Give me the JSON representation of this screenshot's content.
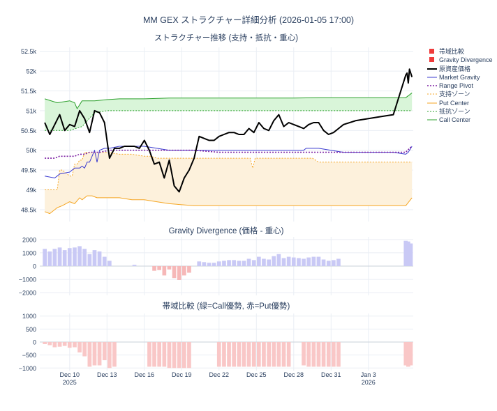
{
  "title": "MM GEX ストラクチャー詳細分析 (2026-01-05 17:00)",
  "panels": {
    "top_title": "ストラクチャー推移 (支持・抵抗・重心)",
    "mid_title": "Gravity Divergence (価格 - 重心)",
    "bot_title": "帯域比較 (緑=Call優勢, 赤=Put優勢)"
  },
  "colors": {
    "price": "#000000",
    "gravity": "#3a3acf",
    "pivot": "#7b1fa2",
    "support": "#f5a623",
    "put_center": "#f5a623",
    "resist": "#2ca02c",
    "call_center": "#2ca02c",
    "support_fill": "#fdf1dc",
    "resist_fill": "#d9f5d9",
    "div_pos": "#c9c9f5",
    "div_neg": "#f6b8b8",
    "band_neg": "#f9c7c7",
    "legend_square": "#ef3b3b",
    "grid": "#eaeef4",
    "zero": "#c9d0da"
  },
  "x_ticks": [
    {
      "label": "Dec 10",
      "sub": "2025",
      "day": 10
    },
    {
      "label": "Dec 13",
      "sub": "",
      "day": 13
    },
    {
      "label": "Dec 16",
      "sub": "",
      "day": 16
    },
    {
      "label": "Dec 19",
      "sub": "",
      "day": 19
    },
    {
      "label": "Dec 22",
      "sub": "",
      "day": 22
    },
    {
      "label": "Dec 25",
      "sub": "",
      "day": 25
    },
    {
      "label": "Dec 28",
      "sub": "",
      "day": 28
    },
    {
      "label": "Dec 31",
      "sub": "",
      "day": 31
    },
    {
      "label": "Jan 3",
      "sub": "2026",
      "day": 34
    }
  ],
  "legend": [
    {
      "label": "帯域比較",
      "kind": "square",
      "color": "#ef3b3b"
    },
    {
      "label": "Gravity Divergence",
      "kind": "square",
      "color": "#ef3b3b"
    },
    {
      "label": "原資産価格",
      "kind": "line",
      "color": "#000000",
      "dash": "",
      "width": 2
    },
    {
      "label": "Market Gravity",
      "kind": "line",
      "color": "#3a3acf",
      "dash": "",
      "width": 1
    },
    {
      "label": "Range Pivot",
      "kind": "line",
      "color": "#7b1fa2",
      "dash": "2,2",
      "width": 1.6
    },
    {
      "label": "支持ゾーン",
      "kind": "line",
      "color": "#f5a623",
      "dash": "2,2",
      "width": 1
    },
    {
      "label": "Put Center",
      "kind": "line",
      "color": "#f5a623",
      "dash": "",
      "width": 1
    },
    {
      "label": "抵抗ゾーン",
      "kind": "line",
      "color": "#2ca02c",
      "dash": "2,2",
      "width": 1
    },
    {
      "label": "Call Center",
      "kind": "line",
      "color": "#2ca02c",
      "dash": "",
      "width": 1
    }
  ],
  "chart_data": [
    {
      "type": "line",
      "title": "ストラクチャー推移 (支持・抵抗・重心)",
      "x_unit": "days since 2025-12-01",
      "xlim": [
        7.6,
        37.6
      ],
      "ylim": [
        48200,
        52600
      ],
      "y_ticks": [
        48500,
        49000,
        49500,
        50000,
        50500,
        51000,
        51500,
        52000,
        52500
      ],
      "y_tick_labels": [
        "48.5k",
        "49k",
        "49.5k",
        "50k",
        "50.5k",
        "51k",
        "51.5k",
        "52k",
        "52.5k"
      ],
      "series": [
        {
          "name": "原資産価格",
          "x": [
            8.0,
            8.4,
            8.8,
            9.2,
            9.6,
            10.0,
            10.4,
            10.8,
            11.2,
            11.6,
            12.0,
            12.4,
            12.8,
            13.2,
            13.6,
            14.0,
            14.4,
            14.8,
            15.2,
            15.6,
            16.0,
            16.4,
            16.8,
            17.2,
            17.6,
            18.0,
            18.4,
            18.8,
            19.2,
            19.6,
            20.0,
            20.4,
            20.8,
            21.2,
            21.6,
            22.0,
            22.4,
            22.8,
            23.2,
            23.6,
            24.0,
            24.4,
            24.8,
            25.2,
            25.6,
            26.0,
            26.4,
            26.8,
            27.2,
            27.6,
            28.0,
            28.4,
            28.8,
            29.2,
            29.6,
            30.0,
            30.4,
            30.8,
            31.2,
            31.6,
            32.0,
            33.0,
            34.0,
            35.0,
            36.0,
            37.0,
            37.1,
            37.2,
            37.3,
            37.4,
            37.5
          ],
          "y": [
            50700,
            50400,
            50650,
            50900,
            50500,
            50650,
            50600,
            51000,
            50800,
            50450,
            51000,
            50950,
            50700,
            49800,
            50050,
            50050,
            50100,
            50100,
            50100,
            50050,
            50250,
            50000,
            49650,
            49700,
            49300,
            49750,
            49100,
            48950,
            49300,
            49500,
            49800,
            50350,
            50300,
            50250,
            50250,
            50350,
            50400,
            50450,
            50450,
            50400,
            50400,
            50550,
            50450,
            50700,
            50550,
            50500,
            50750,
            50900,
            50600,
            50700,
            50650,
            50600,
            50550,
            50650,
            50700,
            50700,
            50500,
            50400,
            50450,
            50550,
            50650,
            50750,
            50800,
            50850,
            50900,
            51900,
            51950,
            51700,
            52050,
            51950,
            51850
          ]
        },
        {
          "name": "Market Gravity",
          "x": [
            8.0,
            8.8,
            9.2,
            10.0,
            10.4,
            10.8,
            11.0,
            11.2,
            11.4,
            11.6,
            11.8,
            12.0,
            12.2,
            12.4,
            12.8,
            13.2,
            14.0,
            16.0,
            18.0,
            20.0,
            22.0,
            24.0,
            26.0,
            28.0,
            28.8,
            29.0,
            30.0,
            31.0,
            32.0,
            34.0,
            36.0,
            37.0,
            37.2,
            37.5
          ],
          "y": [
            49350,
            49300,
            49400,
            49450,
            49550,
            49550,
            49600,
            49550,
            49700,
            49700,
            49850,
            50000,
            49700,
            50000,
            50050,
            50050,
            50100,
            50100,
            50000,
            50000,
            50000,
            50000,
            50000,
            50000,
            50000,
            50050,
            50050,
            50000,
            49950,
            49950,
            49950,
            49900,
            49950,
            50100
          ]
        },
        {
          "name": "Range Pivot",
          "x": [
            8.0,
            8.8,
            9.2,
            10.0,
            10.4,
            10.8,
            11.2,
            11.6,
            12.0,
            12.4,
            13.2,
            14.0,
            16.0,
            18.0,
            20.0,
            22.0,
            24.0,
            26.0,
            28.0,
            30.0,
            32.0,
            34.0,
            36.0,
            37.0,
            37.3,
            37.5
          ],
          "y": [
            49800,
            49800,
            49850,
            49850,
            49850,
            49900,
            49900,
            49950,
            49950,
            49950,
            50000,
            50000,
            50000,
            50000,
            50000,
            49950,
            49950,
            49950,
            49950,
            49950,
            49950,
            49950,
            49950,
            49950,
            50050,
            50100
          ]
        },
        {
          "name": "支持ゾーン",
          "x": [
            8.0,
            8.2,
            9.0,
            9.2,
            9.4,
            10.0,
            10.2,
            10.4,
            10.6,
            10.8,
            11.0,
            11.2,
            11.4,
            11.6,
            12.0,
            12.4,
            13.0,
            14.0,
            15.0,
            16.0,
            16.5,
            17.0,
            18.0,
            19.0,
            20.0,
            21.0,
            22.0,
            23.0,
            24.0,
            24.5,
            24.7,
            24.9,
            25.1,
            26.0,
            27.0,
            28.0,
            29.0,
            29.5,
            30.0,
            31.0,
            32.0,
            33.0,
            34.0,
            35.0,
            36.0,
            37.0,
            37.5
          ],
          "y": [
            49000,
            49000,
            49000,
            49500,
            49500,
            49350,
            49350,
            49650,
            49650,
            49750,
            49750,
            49950,
            49950,
            49950,
            49950,
            49950,
            49950,
            49900,
            49900,
            49850,
            49850,
            49800,
            49800,
            49800,
            49800,
            49800,
            49800,
            49800,
            49800,
            49800,
            49550,
            49800,
            49800,
            49800,
            49800,
            49800,
            49800,
            49800,
            49700,
            49700,
            49700,
            49700,
            49700,
            49700,
            49700,
            49700,
            49700
          ]
        },
        {
          "name": "Put Center",
          "x": [
            8.0,
            8.4,
            9.0,
            9.4,
            10.0,
            10.4,
            10.8,
            11.0,
            11.4,
            11.8,
            12.2,
            12.6,
            13.0,
            14.0,
            15.0,
            16.0,
            17.0,
            18.0,
            20.0,
            22.0,
            24.0,
            26.0,
            28.0,
            30.0,
            32.0,
            34.0,
            36.0,
            37.0,
            37.5
          ],
          "y": [
            48450,
            48400,
            48550,
            48600,
            48700,
            48650,
            48800,
            48750,
            48850,
            48850,
            48800,
            48800,
            48800,
            48800,
            48750,
            48750,
            48700,
            48650,
            48600,
            48600,
            48600,
            48600,
            48600,
            48600,
            48600,
            48600,
            48600,
            48600,
            48800
          ]
        },
        {
          "name": "抵抗ゾーン",
          "x": [
            8.0,
            10.0,
            11.0,
            12.0,
            13.0,
            14.0,
            16.0,
            18.0,
            20.0,
            22.0,
            24.0,
            26.0,
            28.0,
            30.0,
            32.0,
            34.0,
            36.0,
            37.5
          ],
          "y": [
            50500,
            50500,
            50600,
            50950,
            51000,
            51000,
            51000,
            51000,
            51000,
            51000,
            51000,
            51000,
            51000,
            51000,
            51000,
            51000,
            51000,
            51000
          ]
        },
        {
          "name": "Call Center",
          "x": [
            8.0,
            9.0,
            10.0,
            10.4,
            10.6,
            11.0,
            12.0,
            13.0,
            14.0,
            16.0,
            18.0,
            20.0,
            22.0,
            24.0,
            26.0,
            28.0,
            30.0,
            32.0,
            34.0,
            36.0,
            37.0,
            37.3,
            37.5
          ],
          "y": [
            51300,
            51200,
            51250,
            51200,
            51050,
            51250,
            51250,
            51280,
            51300,
            51300,
            51320,
            51320,
            51320,
            51320,
            51320,
            51320,
            51330,
            51330,
            51330,
            51330,
            51330,
            51400,
            51450
          ]
        }
      ]
    },
    {
      "type": "bar",
      "title": "Gravity Divergence (価格 - 重心)",
      "ylim": [
        -2200,
        2200
      ],
      "y_ticks": [
        -2000,
        -1000,
        0,
        1000,
        2000
      ],
      "y_tick_labels": [
        "−2000",
        "−1000",
        "0",
        "1000",
        "2000"
      ],
      "x": [
        8.0,
        8.4,
        8.8,
        9.2,
        9.6,
        10.0,
        10.4,
        10.8,
        11.2,
        11.6,
        12.0,
        12.4,
        12.8,
        13.2,
        13.6,
        14.0,
        14.4,
        14.8,
        15.2,
        15.6,
        16.0,
        16.4,
        16.8,
        17.2,
        17.6,
        18.0,
        18.4,
        18.8,
        19.2,
        19.6,
        20.0,
        20.4,
        20.8,
        21.2,
        21.6,
        22.0,
        22.4,
        22.8,
        23.2,
        23.6,
        24.0,
        24.4,
        24.8,
        25.2,
        25.6,
        26.0,
        26.4,
        26.8,
        27.2,
        27.6,
        28.0,
        28.4,
        28.8,
        29.2,
        29.6,
        30.0,
        30.4,
        30.8,
        31.2,
        31.6,
        37.0,
        37.2,
        37.4
      ],
      "values": [
        1300,
        1100,
        1300,
        1400,
        1200,
        1350,
        1400,
        1500,
        1300,
        900,
        1200,
        1100,
        700,
        400,
        0,
        0,
        0,
        0,
        100,
        0,
        0,
        0,
        -350,
        -300,
        -700,
        -250,
        -900,
        -1050,
        -700,
        -500,
        0,
        350,
        300,
        250,
        250,
        350,
        400,
        450,
        450,
        400,
        400,
        550,
        450,
        700,
        550,
        500,
        750,
        900,
        600,
        700,
        650,
        600,
        550,
        650,
        700,
        700,
        500,
        400,
        450,
        550,
        1900,
        1850,
        1700
      ]
    },
    {
      "type": "bar",
      "title": "帯域比較 (緑=Call優勢, 赤=Put優勢)",
      "ylim": [
        -1100,
        1100
      ],
      "y_ticks": [
        -1000,
        -500,
        0,
        500,
        1000
      ],
      "y_tick_labels": [
        "−1000",
        "−500",
        "0",
        "500",
        "1000"
      ],
      "x": [
        8.0,
        8.4,
        8.8,
        9.2,
        9.6,
        10.0,
        10.4,
        10.8,
        11.2,
        11.6,
        12.0,
        12.4,
        12.8,
        13.2,
        13.6,
        14.0,
        14.4,
        14.8,
        15.2,
        15.6,
        16.0,
        16.4,
        16.8,
        17.2,
        17.6,
        18.0,
        18.4,
        18.8,
        19.2,
        19.6,
        20.0,
        20.4,
        20.8,
        21.2,
        21.6,
        22.0,
        22.4,
        22.8,
        23.2,
        23.6,
        24.0,
        24.4,
        24.8,
        25.2,
        25.6,
        26.0,
        26.4,
        26.8,
        27.2,
        27.6,
        28.0,
        28.4,
        28.8,
        29.2,
        29.6,
        30.0,
        30.4,
        30.8,
        31.2,
        31.6,
        37.0,
        37.2,
        37.4
      ],
      "values": [
        -80,
        -120,
        -200,
        -180,
        -150,
        -220,
        -200,
        -400,
        -550,
        -950,
        -900,
        -900,
        -700,
        -1000,
        -950,
        0,
        0,
        0,
        0,
        0,
        0,
        -950,
        -950,
        -950,
        -950,
        -1000,
        -1000,
        -1000,
        -1000,
        -1000,
        0,
        0,
        0,
        0,
        0,
        -950,
        -950,
        -950,
        -950,
        -950,
        -950,
        -950,
        -950,
        -950,
        -950,
        -950,
        -950,
        -950,
        -950,
        -950,
        0,
        0,
        -900,
        -950,
        -950,
        -950,
        -950,
        -950,
        -950,
        -950,
        -900,
        -950,
        -900
      ]
    }
  ]
}
